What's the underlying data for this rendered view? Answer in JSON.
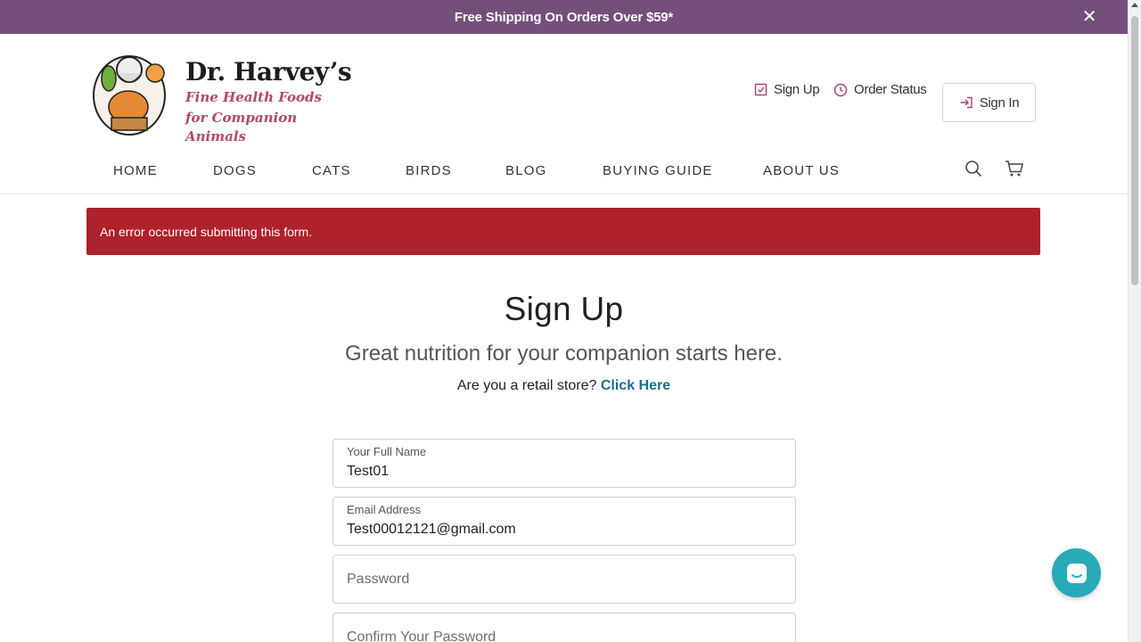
{
  "promo": {
    "text": "Free Shipping On Orders Over $59*",
    "close_glyph": "✕"
  },
  "logo": {
    "title": "Dr. Harvey’s",
    "tagline_line1": "Fine Health Foods",
    "tagline_line2": "for Companion Animals"
  },
  "utility": {
    "signup_label": "Sign Up",
    "order_status_label": "Order Status",
    "signin_label": "Sign In"
  },
  "nav": {
    "items": [
      "HOME",
      "DOGS",
      "CATS",
      "BIRDS",
      "BLOG",
      "BUYING GUIDE",
      "ABOUT US"
    ]
  },
  "error": {
    "message": "An error occurred submitting this form."
  },
  "page": {
    "title": "Sign Up",
    "subtitle": "Great nutrition for your companion starts here.",
    "retail_question": "Are you a retail store?",
    "retail_link": "Click Here"
  },
  "form": {
    "full_name_label": "Your Full Name",
    "full_name_value": "Test01",
    "email_label": "Email Address",
    "email_value": "Test00012121@gmail.com",
    "password_placeholder": "Password",
    "confirm_placeholder": "Confirm Your Password"
  },
  "colors": {
    "promo_bg": "#744f7c",
    "error_bg": "#ae222c",
    "brand_pink": "#b3476a",
    "link_teal": "#1a6f8c",
    "chat_teal": "#27aab7"
  },
  "icons": {
    "signup": "checkbox-icon",
    "order_status": "clock-icon",
    "signin": "sign-in-icon",
    "search": "search-icon",
    "cart": "cart-icon",
    "chat": "chat-icon"
  }
}
